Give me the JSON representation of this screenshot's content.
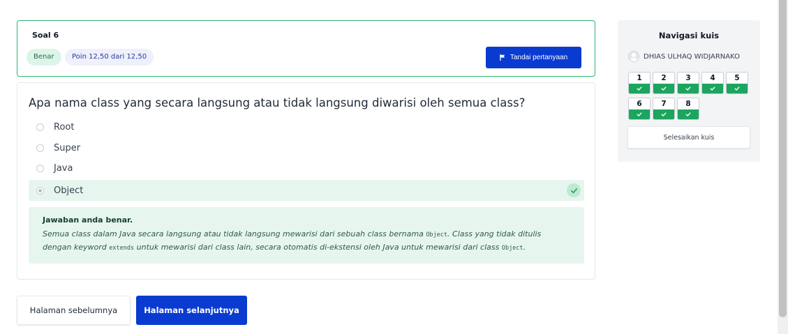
{
  "question": {
    "number_label": "Soal 6",
    "state_badge": "Benar",
    "points_badge": "Poin 12,50 dari 12,50",
    "flag_label": "Tandai pertanyaan",
    "text": "Apa nama class yang secara langsung atau tidak langsung diwarisi oleh semua class?",
    "options": [
      {
        "label": "Root",
        "selected": false
      },
      {
        "label": "Super",
        "selected": false
      },
      {
        "label": "Java",
        "selected": false
      },
      {
        "label": "Object",
        "selected": true
      }
    ],
    "feedback": {
      "title": "Jawaban anda benar.",
      "text_1": "Semua class dalam Java secara langsung atau tidak langsung mewarisi dari sebuah class bernama ",
      "code_1": "Object",
      "text_2": ". Class yang tidak ditulis dengan keyword ",
      "code_2": "extends",
      "text_3": " untuk mewarisi dari class lain, secara otomatis di-ekstensi oleh Java untuk mewarisi dari class ",
      "code_3": "Object",
      "text_4": "."
    }
  },
  "page_nav": {
    "prev_label": "Halaman sebelumnya",
    "next_label": "Halaman selanjutnya"
  },
  "quiz_nav": {
    "title": "Navigasi kuis",
    "user_name": "DHIAS ULHAQ WIDJARNAKO",
    "questions": [
      "1",
      "2",
      "3",
      "4",
      "5",
      "6",
      "7",
      "8"
    ],
    "finish_label": "Selesaikan kuis"
  },
  "colors": {
    "primary": "#0a3bd1",
    "correct": "#1ca55f",
    "correct_bg": "#e6f6ee"
  },
  "icons": [
    "flag-icon",
    "check-icon",
    "avatar-icon"
  ]
}
